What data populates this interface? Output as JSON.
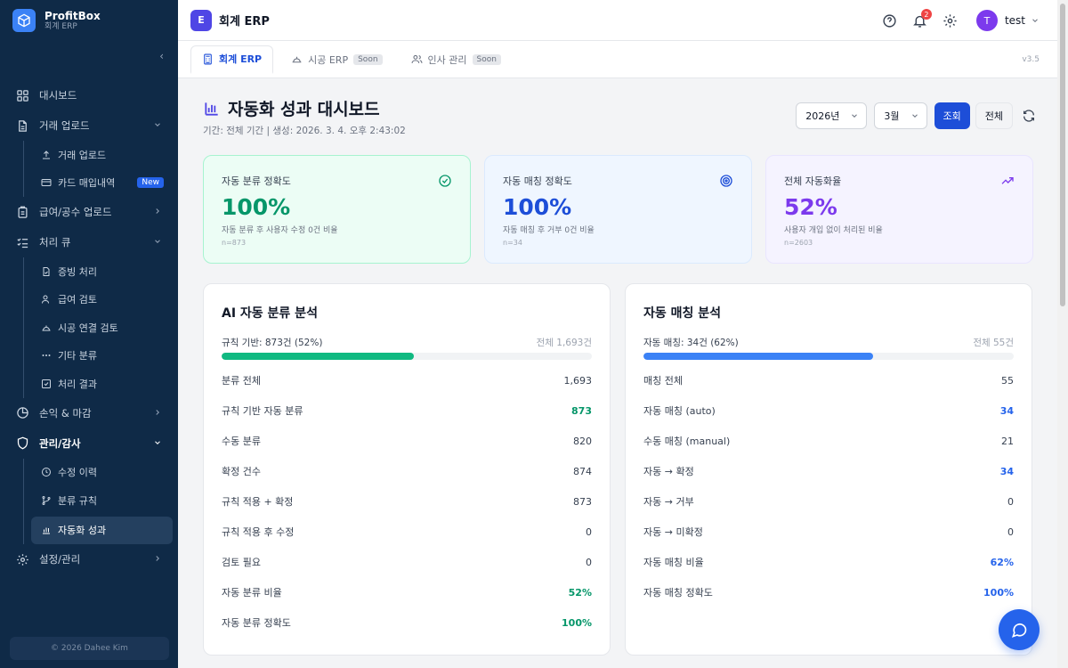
{
  "brand": {
    "name": "ProfitBox",
    "sub": "회계 ERP"
  },
  "sidebar": {
    "items": [
      {
        "label": "대시보드"
      },
      {
        "label": "거래 업로드"
      },
      {
        "label": "급여/공수 업로드"
      },
      {
        "label": "처리 큐"
      },
      {
        "label": "손익 & 마감"
      },
      {
        "label": "관리/감사"
      },
      {
        "label": "설정/관리"
      }
    ],
    "upload_sub": [
      {
        "label": "거래 업로드"
      },
      {
        "label": "카드 매입내역",
        "badge": "New"
      }
    ],
    "queue_sub": [
      {
        "label": "증빙 처리"
      },
      {
        "label": "급여 검토"
      },
      {
        "label": "시공 연결 검토"
      },
      {
        "label": "기타 분류"
      },
      {
        "label": "처리 결과"
      }
    ],
    "admin_sub": [
      {
        "label": "수정 이력"
      },
      {
        "label": "분류 규칙"
      },
      {
        "label": "자동화 성과"
      }
    ],
    "footer": "© 2026 Dahee Kim"
  },
  "header": {
    "app_badge": "E",
    "app_title": "회계 ERP",
    "notif_count": "2",
    "avatar": "T",
    "user": "test"
  },
  "tabs": [
    {
      "label": "회계 ERP"
    },
    {
      "label": "시공 ERP",
      "badge": "Soon"
    },
    {
      "label": "인사 관리",
      "badge": "Soon"
    }
  ],
  "version": "v3.5",
  "page": {
    "title": "자동화 성과 대시보드",
    "subtitle": "기간: 전체 기간 | 생성: 2026. 3. 4. 오후 2:43:02",
    "year": "2026년",
    "month": "3월",
    "search_label": "조회",
    "all_label": "전체"
  },
  "kpis": [
    {
      "label": "자동 분류 정확도",
      "value": "100%",
      "desc": "자동 분류 후 사용자 수정 0건 비율",
      "n": "n=873",
      "color": "#059669"
    },
    {
      "label": "자동 매칭 정확도",
      "value": "100%",
      "desc": "자동 매칭 후 거부 0건 비율",
      "n": "n=34",
      "color": "#1d4ed8"
    },
    {
      "label": "전체 자동화율",
      "value": "52%",
      "desc": "사용자 개입 없이 처리된 비율",
      "n": "n=2603",
      "color": "#7c3aed"
    }
  ],
  "ai_panel": {
    "title": "AI 자동 분류 분석",
    "bar_label": "규칙 기반: 873건 (52%)",
    "bar_total": "전체 1,693건",
    "bar_fraction": 0.52,
    "rows": [
      {
        "label": "분류 전체",
        "value": "1,693",
        "tone": ""
      },
      {
        "label": "규칙 기반 자동 분류",
        "value": "873",
        "tone": "green"
      },
      {
        "label": "수동 분류",
        "value": "820",
        "tone": ""
      },
      {
        "label": "확정 건수",
        "value": "874",
        "tone": ""
      },
      {
        "label": "규칙 적용 + 확정",
        "value": "873",
        "tone": ""
      },
      {
        "label": "규칙 적용 후 수정",
        "value": "0",
        "tone": ""
      },
      {
        "label": "검토 필요",
        "value": "0",
        "tone": ""
      },
      {
        "label": "자동 분류 비율",
        "value": "52%",
        "tone": "green"
      },
      {
        "label": "자동 분류 정확도",
        "value": "100%",
        "tone": "green"
      }
    ]
  },
  "match_panel": {
    "title": "자동 매칭 분석",
    "bar_label": "자동 매칭: 34건 (62%)",
    "bar_total": "전체 55건",
    "bar_fraction": 0.62,
    "rows": [
      {
        "label": "매칭 전체",
        "value": "55",
        "tone": ""
      },
      {
        "label": "자동 매칭 (auto)",
        "value": "34",
        "tone": "blue"
      },
      {
        "label": "수동 매칭 (manual)",
        "value": "21",
        "tone": ""
      },
      {
        "label": "자동 → 확정",
        "value": "34",
        "tone": "blue"
      },
      {
        "label": "자동 → 거부",
        "value": "0",
        "tone": ""
      },
      {
        "label": "자동 → 미확정",
        "value": "0",
        "tone": ""
      },
      {
        "label": "자동 매칭 비율",
        "value": "62%",
        "tone": "blue"
      },
      {
        "label": "자동 매칭 정확도",
        "value": "100%",
        "tone": "blue"
      }
    ]
  },
  "colors": {
    "accent": "#1d4ed8",
    "sidebar": "#0f2a47",
    "green": "#10b981",
    "blue": "#3b82f6"
  }
}
